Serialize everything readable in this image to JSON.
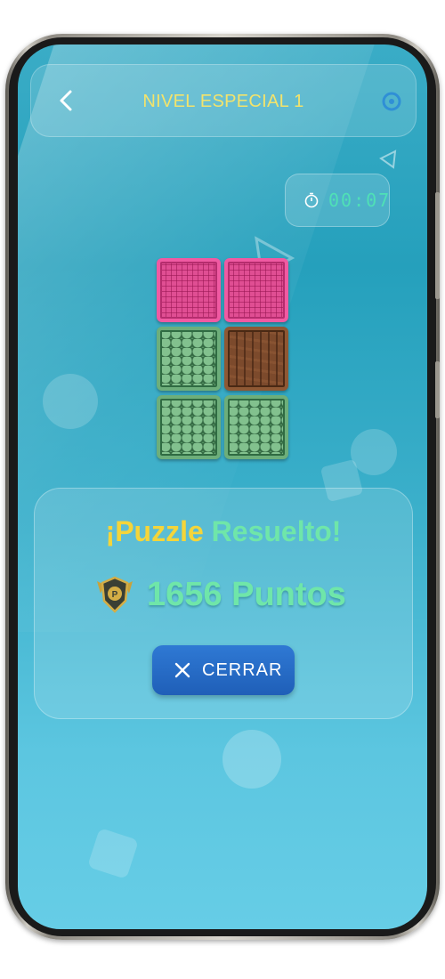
{
  "header": {
    "title": "NIVEL ESPECIAL 1",
    "back_icon": "chevron-left-icon",
    "settings_icon": "gear-icon"
  },
  "timer": {
    "value": "00:07",
    "icon": "stopwatch-icon"
  },
  "puzzle": {
    "tiles": [
      {
        "row": 1,
        "col": 1,
        "kind": "pink"
      },
      {
        "row": 1,
        "col": 2,
        "kind": "pink"
      },
      {
        "row": 2,
        "col": 1,
        "kind": "green"
      },
      {
        "row": 2,
        "col": 2,
        "kind": "wood"
      },
      {
        "row": 3,
        "col": 1,
        "kind": "green"
      },
      {
        "row": 3,
        "col": 2,
        "kind": "green"
      }
    ]
  },
  "result": {
    "headline_part1": "¡Puzzle",
    "headline_part2": "Resuelto!",
    "points": "1656 Puntos",
    "badge_icon": "shield-badge-icon"
  },
  "actions": {
    "close_label": "CERRAR",
    "close_icon": "close-icon"
  },
  "colors": {
    "title": "#f3e36b",
    "timer_text": "#4fe0b6",
    "headline_yellow": "#f4d53a",
    "headline_green": "#6fe6a9",
    "button_blue": "#2f79d4",
    "screen_bg": "#25a0bc"
  }
}
